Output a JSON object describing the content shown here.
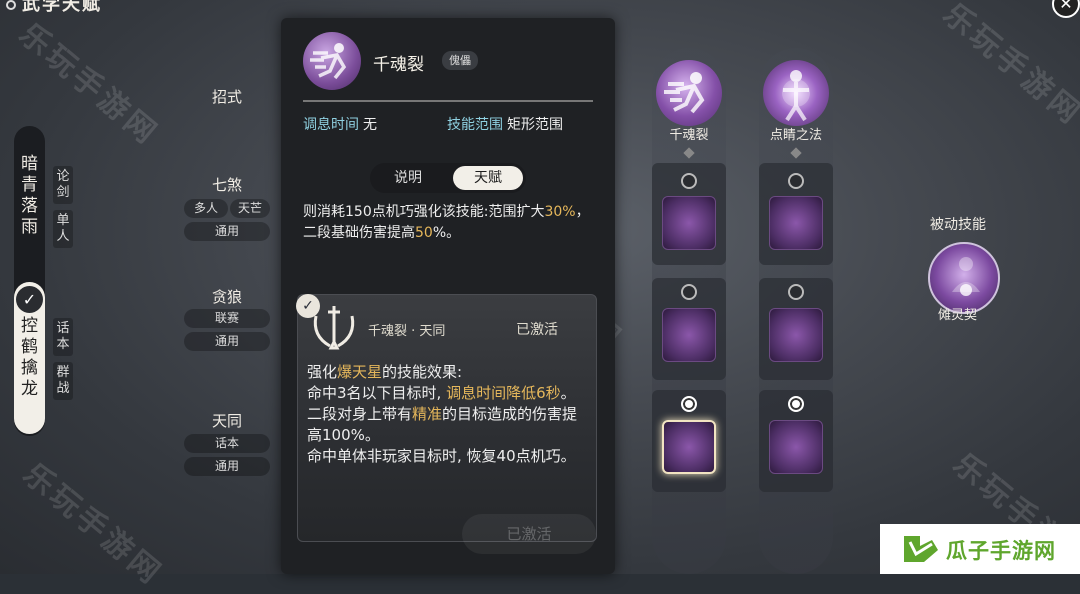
{
  "header": {
    "title": "武学天赋",
    "close_icon": "close-icon"
  },
  "watermark": "乐玩手游网",
  "left_panel": {
    "school_top": "暗青落雨",
    "school_bottom": "控鹤擒龙",
    "side_tags_top": [
      "论剑",
      "单人"
    ],
    "side_tags_bottom": [
      "话本",
      "群战"
    ]
  },
  "categories": [
    {
      "title": "招式",
      "tags": []
    },
    {
      "title": "七煞",
      "tags": [
        "多人",
        "天芒",
        "通用"
      ]
    },
    {
      "title": "贪狼",
      "tags": [
        "联赛",
        "通用"
      ]
    },
    {
      "title": "天同",
      "tags": [
        "话本",
        "通用"
      ]
    }
  ],
  "popup": {
    "skill_name": "千魂裂",
    "badge": "傀儡",
    "cooldown_label": "调息时间",
    "cooldown_value": "无",
    "range_label": "技能范围",
    "range_value": "矩形范围",
    "tabs": [
      "说明",
      "天赋"
    ],
    "active_tab": "天赋",
    "desc_pre": "则消耗150点机巧强化该技能:范围扩大",
    "desc_pct1": "30%",
    "desc_mid": "，二段基础伤害提高",
    "desc_pct2": "50",
    "desc_end": "%。",
    "talent": {
      "name": "千魂裂 · 天同",
      "status": "已激活",
      "line1_pre": "强化",
      "line1_gold": "爆天星",
      "line1_post": "的技能效果:",
      "line2_pre": "命中3名以下目标时, ",
      "line2_gold": "调息时间降低6秒",
      "line2_post": "。",
      "line3_pre": "二段对身上带有",
      "line3_gold": "精准",
      "line3_post": "的目标造成的伤害提高100%。",
      "line4": "命中单体非玩家目标时, 恢复40点机巧。"
    },
    "ghost_button": "已激活"
  },
  "skill_columns": [
    {
      "label": "千魂裂"
    },
    {
      "label": "点睛之法"
    }
  ],
  "passive": {
    "title": "被动技能",
    "name": "傩灵契"
  },
  "logo": {
    "text": "瓜子手游网"
  },
  "colors": {
    "accent_gold": "#e5b75b",
    "accent_cyan": "#8fd0e0",
    "purple": "#7b4d9a"
  }
}
